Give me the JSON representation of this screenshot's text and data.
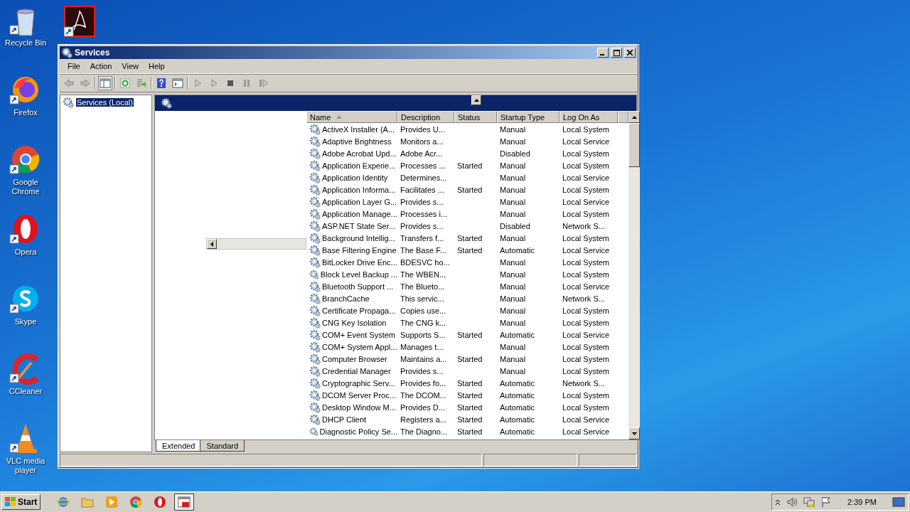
{
  "desktop": {
    "icons": [
      {
        "kind": "recycle",
        "label": "Recycle Bin"
      },
      {
        "kind": "firefox",
        "label": "Firefox"
      },
      {
        "kind": "chrome",
        "label": "Google Chrome"
      },
      {
        "kind": "opera",
        "label": "Opera"
      },
      {
        "kind": "skype",
        "label": "Skype"
      },
      {
        "kind": "ccleaner",
        "label": "CCleaner"
      },
      {
        "kind": "vlc",
        "label": "VLC media player"
      }
    ]
  },
  "window": {
    "title": "Services",
    "menu": [
      "File",
      "Action",
      "View",
      "Help"
    ],
    "tree": [
      {
        "label": "Services (Local)",
        "selected": true
      }
    ],
    "table": {
      "columns": [
        {
          "label": "Name",
          "sorted": true
        },
        {
          "label": "Description",
          "sorted": false
        },
        {
          "label": "Status",
          "sorted": false
        },
        {
          "label": "Startup Type",
          "sorted": false
        },
        {
          "label": "Log On As",
          "sorted": false
        }
      ],
      "rows": [
        [
          "ActiveX Installer (A...",
          "Provides U...",
          "",
          "Manual",
          "Local System"
        ],
        [
          "Adaptive Brightness",
          "Monitors a...",
          "",
          "Manual",
          "Local Service"
        ],
        [
          "Adobe Acrobat Upd...",
          "Adobe Acr...",
          "",
          "Disabled",
          "Local System"
        ],
        [
          "Application Experie...",
          "Processes ...",
          "Started",
          "Manual",
          "Local System"
        ],
        [
          "Application Identity",
          "Determines...",
          "",
          "Manual",
          "Local Service"
        ],
        [
          "Application Informa...",
          "Facilitates ...",
          "Started",
          "Manual",
          "Local System"
        ],
        [
          "Application Layer G...",
          "Provides s...",
          "",
          "Manual",
          "Local Service"
        ],
        [
          "Application Manage...",
          "Processes i...",
          "",
          "Manual",
          "Local System"
        ],
        [
          "ASP.NET State Ser...",
          "Provides s...",
          "",
          "Disabled",
          "Network S..."
        ],
        [
          "Background Intellig...",
          "Transfers f...",
          "Started",
          "Manual",
          "Local System"
        ],
        [
          "Base Filtering Engine",
          "The Base F...",
          "Started",
          "Automatic",
          "Local Service"
        ],
        [
          "BitLocker Drive Enc...",
          "BDESVC ho...",
          "",
          "Manual",
          "Local System"
        ],
        [
          "Block Level Backup ...",
          "The WBEN...",
          "",
          "Manual",
          "Local System"
        ],
        [
          "Bluetooth Support ...",
          "The Blueto...",
          "",
          "Manual",
          "Local Service"
        ],
        [
          "BranchCache",
          "This servic...",
          "",
          "Manual",
          "Network S..."
        ],
        [
          "Certificate Propaga...",
          "Copies use...",
          "",
          "Manual",
          "Local System"
        ],
        [
          "CNG Key Isolation",
          "The CNG k...",
          "",
          "Manual",
          "Local System"
        ],
        [
          "COM+ Event System",
          "Supports S...",
          "Started",
          "Automatic",
          "Local Service"
        ],
        [
          "COM+ System Appl...",
          "Manages t...",
          "",
          "Manual",
          "Local System"
        ],
        [
          "Computer Browser",
          "Maintains a...",
          "Started",
          "Manual",
          "Local System"
        ],
        [
          "Credential Manager",
          "Provides s...",
          "",
          "Manual",
          "Local System"
        ],
        [
          "Cryptographic Serv...",
          "Provides fo...",
          "Started",
          "Automatic",
          "Network S..."
        ],
        [
          "DCOM Server Proc...",
          "The DCOM...",
          "Started",
          "Automatic",
          "Local System"
        ],
        [
          "Desktop Window M...",
          "Provides D...",
          "Started",
          "Automatic",
          "Local System"
        ],
        [
          "DHCP Client",
          "Registers a...",
          "Started",
          "Automatic",
          "Local Service"
        ],
        [
          "Diagnostic Policy Se...",
          "The Diagno...",
          "Started",
          "Automatic",
          "Local Service"
        ]
      ]
    },
    "tabs": [
      {
        "label": "Extended",
        "selected": true
      },
      {
        "label": "Standard",
        "selected": false
      }
    ]
  },
  "taskbar": {
    "start": "Start",
    "clock": "2:39 PM"
  }
}
